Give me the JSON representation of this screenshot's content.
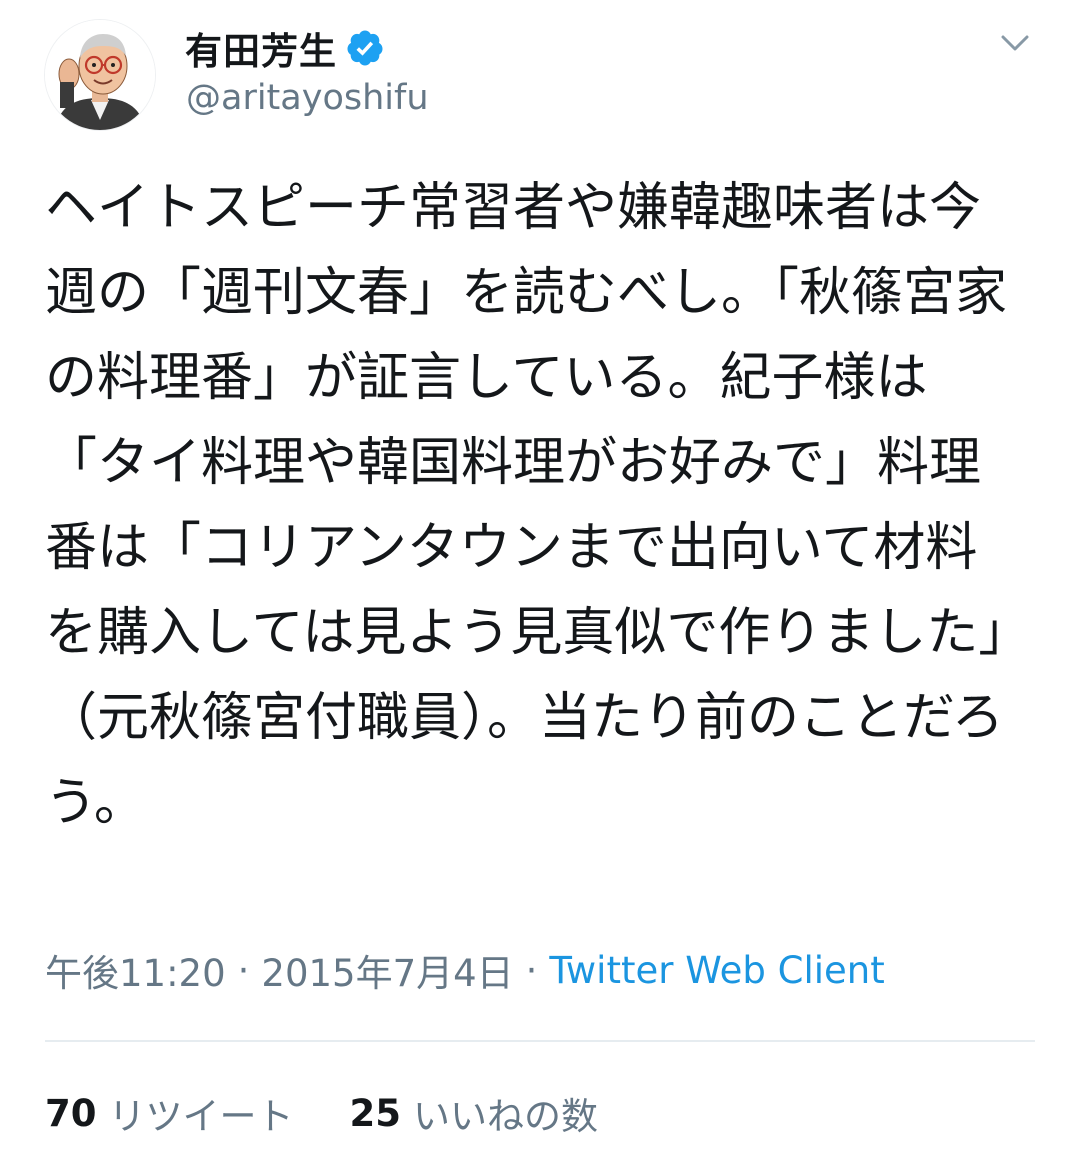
{
  "tweet": {
    "author": {
      "display_name": "有田芳生",
      "handle": "@aritayoshifu",
      "verified": true,
      "avatar_icon": "caricature-avatar"
    },
    "menu_icon": "chevron-down-icon",
    "text": "ヘイトスピーチ常習者や嫌韓趣味者は今週の「週刊文春」を読むべし。「秋篠宮家の料理番」が証言している。紀子様は「タイ料理や韓国料理がお好みで」料理番は「コリアンタウンまで出向いて材料を購入しては見よう見真似で作りました」（元秋篠宮付職員）。当たり前のことだろう。",
    "meta": {
      "time": "午後11:20",
      "separator": "·",
      "date": "2015年7月4日",
      "client": "Twitter Web Client"
    },
    "stats": {
      "retweets_count": "70",
      "retweets_label": "リツイート",
      "likes_count": "25",
      "likes_label": "いいねの数"
    }
  },
  "colors": {
    "text_primary": "#14171a",
    "text_secondary": "#657786",
    "link": "#1b95e0",
    "verified_badge": "#1da1f2",
    "divider": "#e6ecf0"
  }
}
